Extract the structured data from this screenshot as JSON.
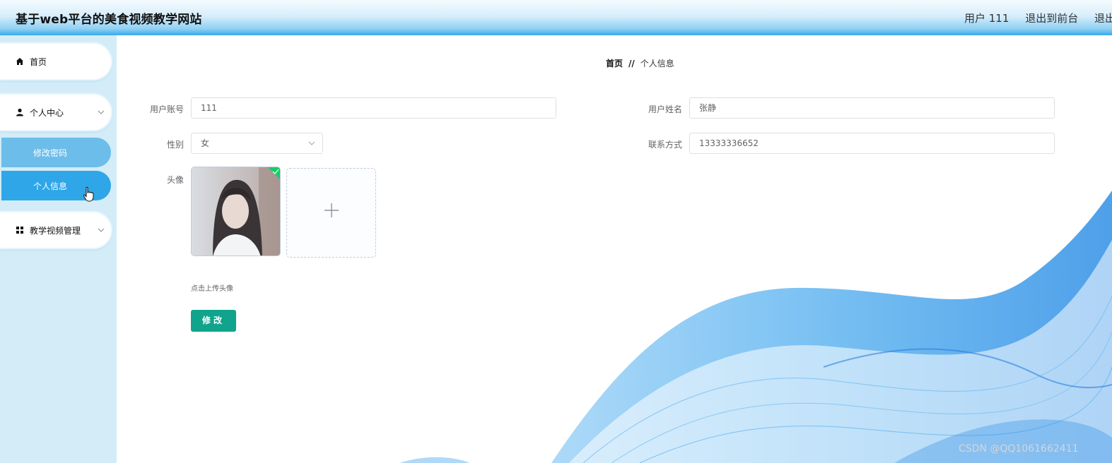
{
  "header": {
    "title": "基于web平台的美食视频教学网站",
    "user_label": "用户 111",
    "back_to_front": "退出到前台",
    "logout": "退出"
  },
  "sidebar": {
    "home": "首页",
    "personal_center": "个人中心",
    "change_password": "修改密码",
    "personal_info": "个人信息",
    "video_management": "教学视频管理"
  },
  "breadcrumb": {
    "home": "首页",
    "separator": "//",
    "current": "个人信息"
  },
  "form": {
    "account_label": "用户账号",
    "account_value": "111",
    "name_label": "用户姓名",
    "name_value": "张静",
    "gender_label": "性别",
    "gender_value": "女",
    "contact_label": "联系方式",
    "contact_value": "13333336652",
    "avatar_label": "头像",
    "upload_hint": "点击上传头像",
    "submit_label": "修改"
  },
  "watermark": "CSDN @QQ1061662411",
  "colors": {
    "header_accent": "#35a9ea",
    "sidebar_bg": "#d3ecf8",
    "active_item": "#2fa6e8",
    "sub_item": "#6cbde9",
    "submit_button": "#10a48c"
  }
}
